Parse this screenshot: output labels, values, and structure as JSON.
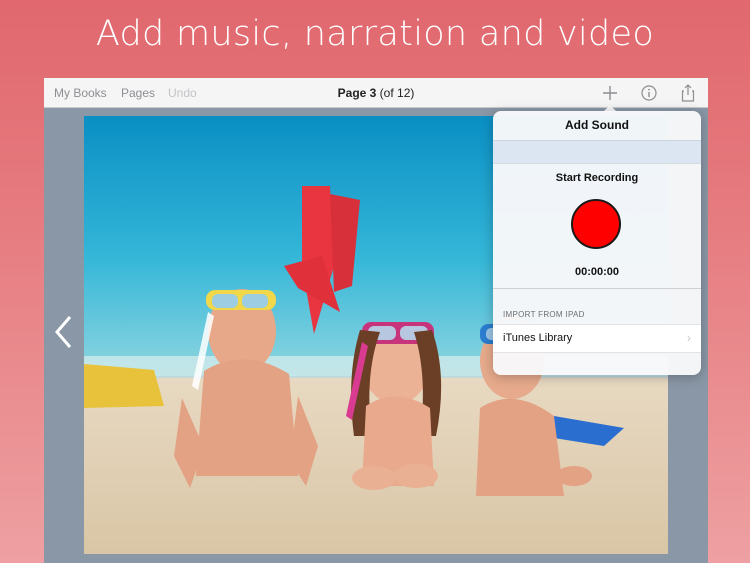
{
  "headline": "Add music, narration and video",
  "toolbar": {
    "my_books": "My Books",
    "pages": "Pages",
    "undo": "Undo",
    "page_prefix": "Page 3",
    "page_suffix": " (of 12)"
  },
  "icons": [
    "plus-icon",
    "info-icon",
    "share-icon",
    "chevron-left-icon",
    "chevron-right-icon"
  ],
  "popover": {
    "title": "Add Sound",
    "recording_label": "Start Recording",
    "timer": "00:00:00",
    "import_section": "IMPORT FROM IPAD",
    "itunes_label": "iTunes Library",
    "chevron": "›"
  },
  "colors": {
    "record_button": "#ff0000",
    "background_top": "#e0686e",
    "background_bottom": "#eea0a2"
  }
}
